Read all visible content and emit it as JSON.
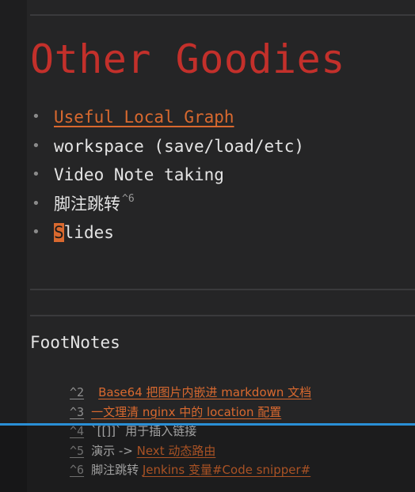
{
  "slide": {
    "title": "Other Goodies",
    "bullets": [
      {
        "text": "Useful Local Graph"
      },
      {
        "text": "workspace (save/load/etc)"
      },
      {
        "text": "Video Note taking"
      },
      {
        "text": "脚注跳转",
        "sup": "^6"
      },
      {
        "cursor_char": "S",
        "rest": "lides"
      }
    ]
  },
  "footnotes": {
    "heading": "FootNotes",
    "items": [
      {
        "num": "^2",
        "text_before": "",
        "link": "Base64 把图片内嵌进 markdown 文档",
        "text_after": ""
      },
      {
        "num": "^3",
        "text_before": "",
        "link": "一文理清 nginx 中的 location 配置",
        "text_after": ""
      },
      {
        "num": "^4",
        "text_before": "`[[]]` 用于插入链接",
        "link": "",
        "text_after": ""
      },
      {
        "num": "^5",
        "text_before": "演示 -> ",
        "link": "Next 动态路由",
        "text_after": ""
      },
      {
        "num": "^6",
        "text_before": "脚注跳转 ",
        "link": "Jenkins 变量#Code snipper#",
        "text_after": ""
      }
    ]
  },
  "video": {
    "progress": 1.0,
    "progress_color": "#2a8fd6"
  },
  "colors": {
    "background": "#252526",
    "heading": "#c3302b",
    "link": "#d9692f"
  }
}
